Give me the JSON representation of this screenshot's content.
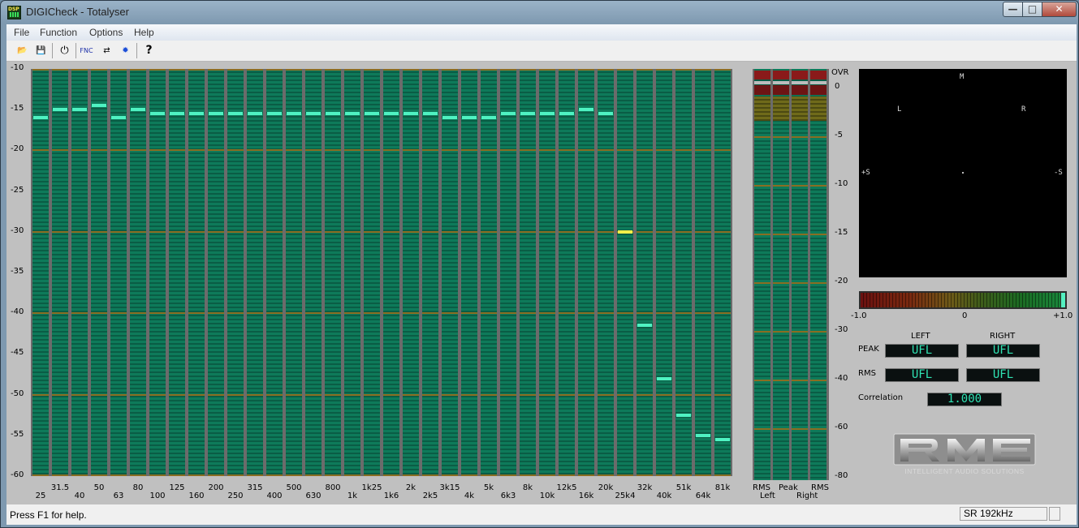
{
  "window": {
    "title": "DIGICheck - Totalyser",
    "icon_text": "DSP",
    "min": "—",
    "max": "□",
    "close": "✕"
  },
  "menu": [
    "File",
    "Function",
    "Options",
    "Help"
  ],
  "toolbar": [
    {
      "icon": "open-folder-icon",
      "glyph": "📂"
    },
    {
      "icon": "save-icon",
      "glyph": "💾"
    },
    {
      "icon": "power-icon",
      "glyph": "⏻"
    },
    {
      "icon": "function-icon",
      "glyph": "FNC"
    },
    {
      "icon": "settings-icon",
      "glyph": "⇄"
    },
    {
      "icon": "brightness-icon",
      "glyph": "✹"
    },
    {
      "icon": "help-icon",
      "glyph": "?"
    }
  ],
  "spectrum": {
    "y_labels": [
      "-10",
      "-15",
      "-20",
      "-25",
      "-30",
      "-35",
      "-40",
      "-45",
      "-50",
      "-55",
      "-60"
    ],
    "ylim": [
      -60,
      -10
    ],
    "bands": [
      "25",
      "31.5",
      "40",
      "50",
      "63",
      "80",
      "100",
      "125",
      "160",
      "200",
      "250",
      "315",
      "400",
      "500",
      "630",
      "800",
      "1k",
      "1k25",
      "1k6",
      "2k",
      "2k5",
      "3k15",
      "4k",
      "5k",
      "6k3",
      "8k",
      "10k",
      "12k5",
      "16k",
      "20k",
      "25k4",
      "32k",
      "40k",
      "51k",
      "64k",
      "81k"
    ],
    "peaks": [
      -16,
      -15,
      -15,
      -14.5,
      -16,
      -15,
      -15.5,
      -15.5,
      -15.5,
      -15.5,
      -15.5,
      -15.5,
      -15.5,
      -15.5,
      -15.5,
      -15.5,
      -15.5,
      -15.5,
      -15.5,
      -15.5,
      -15.5,
      -16,
      -16,
      -16,
      -15.5,
      -15.5,
      -15.5,
      -15.5,
      -15,
      -15.5,
      -30,
      -41.5,
      -48,
      -52.5,
      -55,
      -55.5
    ],
    "highlight_band_index": 30,
    "peak_color": "#4ff2c2",
    "highlight_color": "#f2ee4a",
    "bar_color": "#0e7a5a",
    "grid_color": "#8a6d22"
  },
  "level_meter": {
    "scale": [
      "OVR",
      "0",
      "-5",
      "-10",
      "-15",
      "-20",
      "-30",
      "-40",
      "-60",
      "-80"
    ],
    "columns": [
      "RMS",
      "Peak",
      "Peak",
      "RMS"
    ],
    "column_labels_bottom": [
      "RMS",
      "Peak",
      "RMS"
    ],
    "channel_labels": [
      "Left",
      "Right"
    ]
  },
  "goniometer": {
    "labels": {
      "m": "M",
      "l": "L",
      "r": "R",
      "plus_s": "+S",
      "minus_s": "-S"
    }
  },
  "correlation_scale": {
    "min": "-1.0",
    "mid": "0",
    "max": "+1.0",
    "value": 1.0
  },
  "readouts": {
    "left": "LEFT",
    "right": "RIGHT",
    "peak_label": "PEAK",
    "rms_label": "RMS",
    "peak_left": "UFL",
    "peak_right": "UFL",
    "rms_left": "UFL",
    "rms_right": "UFL",
    "correlation_label": "Correlation",
    "correlation_value": "1.000"
  },
  "logo": {
    "brand": "RME",
    "tagline": "INTELLIGENT AUDIO SOLUTIONS"
  },
  "status": {
    "text": "Press F1 for help.",
    "sample_rate": "SR 192kHz"
  }
}
